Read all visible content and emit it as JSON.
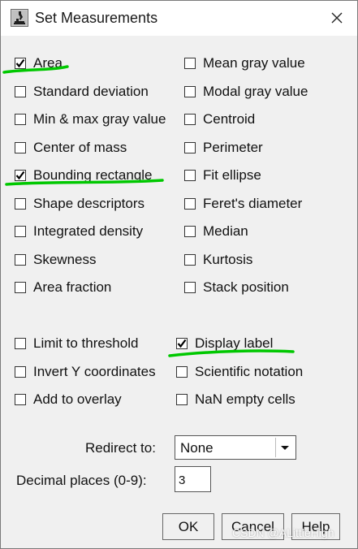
{
  "window": {
    "title": "Set Measurements"
  },
  "measurements": {
    "area": {
      "label": "Area",
      "checked": true
    },
    "mean_gray": {
      "label": "Mean gray value",
      "checked": false
    },
    "std_dev": {
      "label": "Standard deviation",
      "checked": false
    },
    "modal_gray": {
      "label": "Modal gray value",
      "checked": false
    },
    "min_max": {
      "label": "Min & max gray value",
      "checked": false
    },
    "centroid": {
      "label": "Centroid",
      "checked": false
    },
    "center_mass": {
      "label": "Center of mass",
      "checked": false
    },
    "perimeter": {
      "label": "Perimeter",
      "checked": false
    },
    "bounding": {
      "label": "Bounding rectangle",
      "checked": true
    },
    "fit_ellipse": {
      "label": "Fit ellipse",
      "checked": false
    },
    "shape": {
      "label": "Shape descriptors",
      "checked": false
    },
    "feret": {
      "label": "Feret's diameter",
      "checked": false
    },
    "int_density": {
      "label": "Integrated density",
      "checked": false
    },
    "median": {
      "label": "Median",
      "checked": false
    },
    "skewness": {
      "label": "Skewness",
      "checked": false
    },
    "kurtosis": {
      "label": "Kurtosis",
      "checked": false
    },
    "area_fraction": {
      "label": "Area fraction",
      "checked": false
    },
    "stack_position": {
      "label": "Stack position",
      "checked": false
    }
  },
  "options": {
    "limit_threshold": {
      "label": "Limit to threshold",
      "checked": false
    },
    "display_label": {
      "label": "Display label",
      "checked": true
    },
    "invert_y": {
      "label": "Invert Y coordinates",
      "checked": false
    },
    "scientific": {
      "label": "Scientific notation",
      "checked": false
    },
    "add_overlay": {
      "label": "Add to overlay",
      "checked": false
    },
    "nan_empty": {
      "label": "NaN empty cells",
      "checked": false
    }
  },
  "redirect": {
    "label": "Redirect to:",
    "value": "None"
  },
  "decimal": {
    "label": "Decimal places (0-9):",
    "value": "3"
  },
  "buttons": {
    "ok": "OK",
    "cancel": "Cancel",
    "help": "Help"
  },
  "watermark": "CSDN @ALittleHigh",
  "colors": {
    "highlight": "#00c800"
  },
  "icons": {
    "app": "imagej-microscope-icon",
    "close": "close-icon",
    "dropdown": "dropdown-arrow-icon",
    "check": "check-icon"
  }
}
